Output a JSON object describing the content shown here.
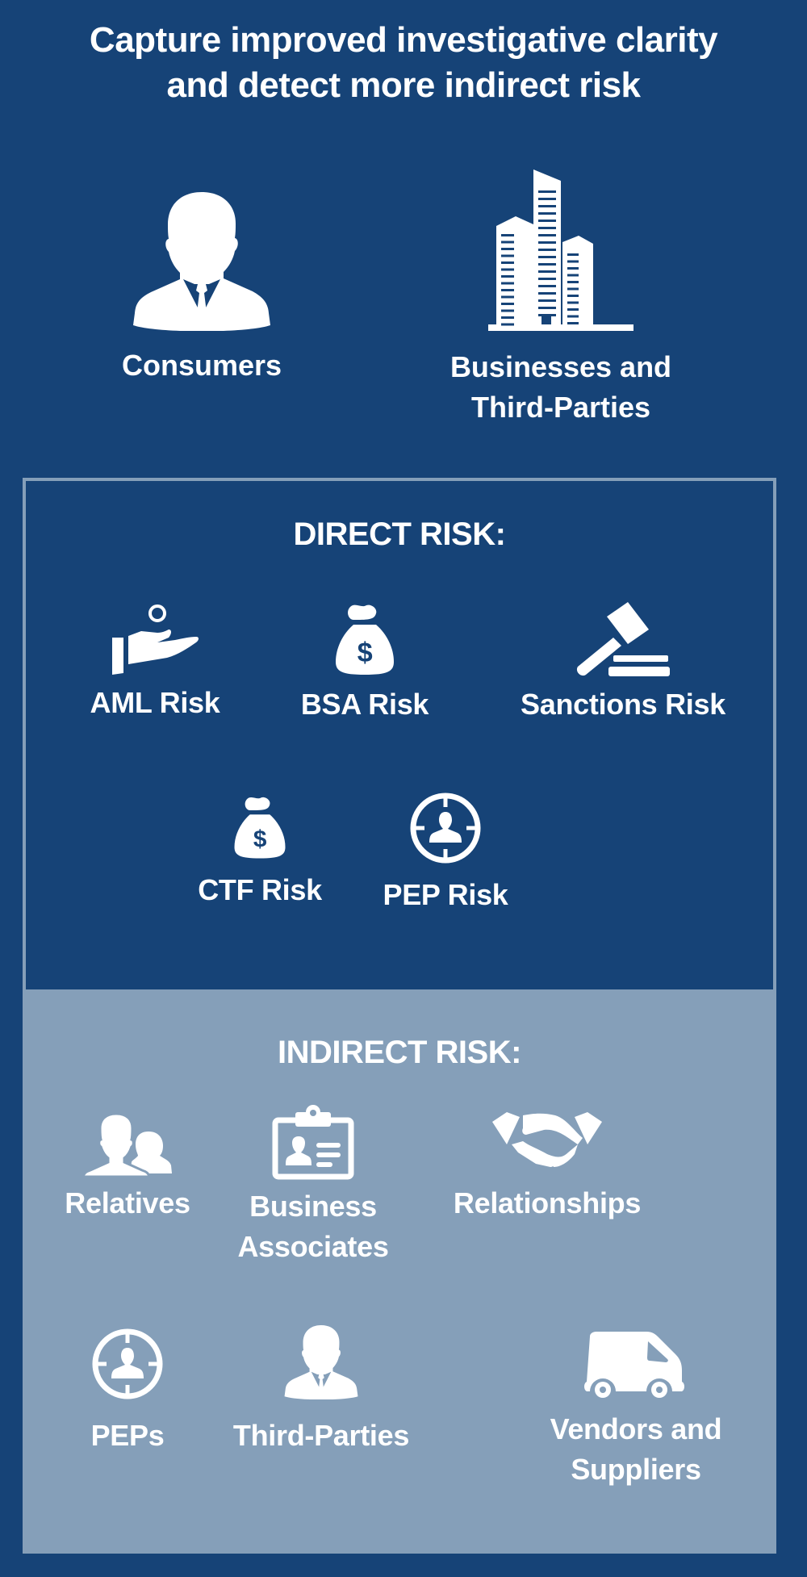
{
  "header": {
    "title_line1": "Capture improved investigative clarity",
    "title_line2": "and detect more indirect risk"
  },
  "entities": [
    {
      "icon": "person-icon",
      "label": "Consumers"
    },
    {
      "icon": "buildings-icon",
      "label_line1": "Businesses and",
      "label_line2": "Third-Parties"
    }
  ],
  "direct_risk": {
    "title": "DIRECT RISK:",
    "items": [
      {
        "icon": "hand-coin-icon",
        "label": "AML Risk"
      },
      {
        "icon": "money-bag-icon",
        "label": "BSA Risk"
      },
      {
        "icon": "gavel-icon",
        "label": "Sanctions Risk"
      },
      {
        "icon": "money-bag-icon",
        "label": "CTF Risk"
      },
      {
        "icon": "target-person-icon",
        "label": "PEP Risk"
      }
    ]
  },
  "indirect_risk": {
    "title": "INDIRECT RISK:",
    "items": [
      {
        "icon": "two-people-icon",
        "label": "Relatives"
      },
      {
        "icon": "id-badge-icon",
        "label_line1": "Business",
        "label_line2": "Associates"
      },
      {
        "icon": "handshake-icon",
        "label": "Relationships"
      },
      {
        "icon": "target-person-icon",
        "label": "PEPs"
      },
      {
        "icon": "person-icon",
        "label": "Third-Parties"
      },
      {
        "icon": "van-icon",
        "label_line1": "Vendors and",
        "label_line2": "Suppliers"
      }
    ]
  },
  "colors": {
    "background": "#164377",
    "indirect_panel": "#859fb9",
    "text": "#ffffff"
  }
}
